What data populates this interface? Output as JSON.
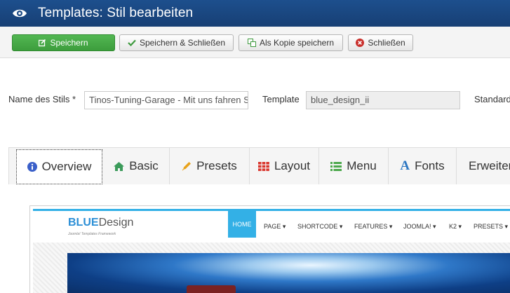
{
  "header": {
    "title": "Templates: Stil bearbeiten",
    "icon": "eye-icon"
  },
  "toolbar": {
    "save_label": "Speichern",
    "save_close_label": "Speichern & Schließen",
    "save_copy_label": "Als Kopie speichern",
    "close_label": "Schließen",
    "colors": {
      "save": "#46a546",
      "close_icon": "#c9302c"
    }
  },
  "form": {
    "style_name_label": "Name des Stils *",
    "style_name_value": "Tinos-Tuning-Garage - Mit uns fahren Sie sicher",
    "template_label": "Template",
    "template_value": "blue_design_ii",
    "default_label": "Standard"
  },
  "tabs": [
    {
      "label": "Overview",
      "icon": "info-icon",
      "color": "#3a5fc9"
    },
    {
      "label": "Basic",
      "icon": "home-icon",
      "color": "#3b9b5a"
    },
    {
      "label": "Presets",
      "icon": "pencil-icon",
      "color": "#e8a21a"
    },
    {
      "label": "Layout",
      "icon": "grid-icon",
      "color": "#d9342b"
    },
    {
      "label": "Menu",
      "icon": "list-icon",
      "color": "#4aa84a"
    },
    {
      "label": "Fonts",
      "icon": "font-icon",
      "color": "#2d77c2"
    },
    {
      "label": "Erweiter",
      "icon": "",
      "color": "#333333"
    }
  ],
  "preview": {
    "logo_bold": "BLUE",
    "logo_rest": "Design",
    "logo_sub": "Joomla! Templates Framework",
    "nav": [
      "HOME",
      "PAGE ▾",
      "SHORTCODE ▾",
      "FEATURES ▾",
      "JOOMLA! ▾",
      "K2 ▾",
      "PRESETS ▾"
    ],
    "accent": "#33b0e6"
  }
}
